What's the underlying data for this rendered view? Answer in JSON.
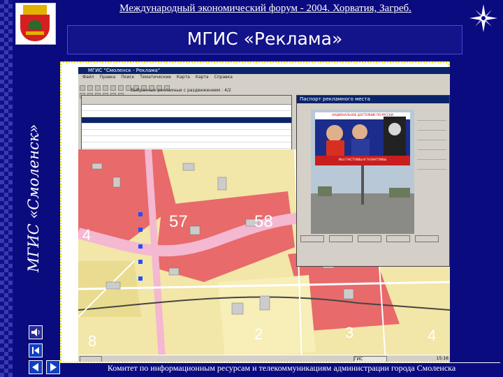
{
  "header": {
    "forum_line": "Международный экономический форум - 2004. Хорватия, Загреб.",
    "banner_title": "МГИС «Реклама»",
    "vertical_title": "МГИС «Смоленск»"
  },
  "app": {
    "window_title": "МГИС \"Смоленск - Реклама\"",
    "menu": [
      "Файл",
      "Правка",
      "Поиск",
      "Тематические",
      "Карта",
      "Карта",
      "Справка"
    ],
    "toolbar_hint": "Выбранные рекламные с раздвижением : 4/2",
    "passport_title": "Паспорт рекламного места",
    "billboard_top_text": "НАЦИОНАЛЬНОЕ ДОСТОЯНИЕ ПО-РУССКИ",
    "billboard_bottom_text": "МЫ СЧАСТЛИВЫ И ТАЛАНТЛИВЫ",
    "map_labels": [
      "4",
      "57",
      "58",
      "8",
      "2",
      "3",
      "4"
    ],
    "taskbar_active": "ГИС \"Смолен...",
    "clock": "15:16"
  },
  "footer": "Комитет по информационным ресурсам и телекоммуникациям администрации города Смоленска",
  "colors": {
    "background": "#0b0b80",
    "map_base": "#f2e6a8",
    "map_red": "#e86a6a",
    "map_road": "#f4b8d0",
    "titlebar": "#0a246a"
  }
}
